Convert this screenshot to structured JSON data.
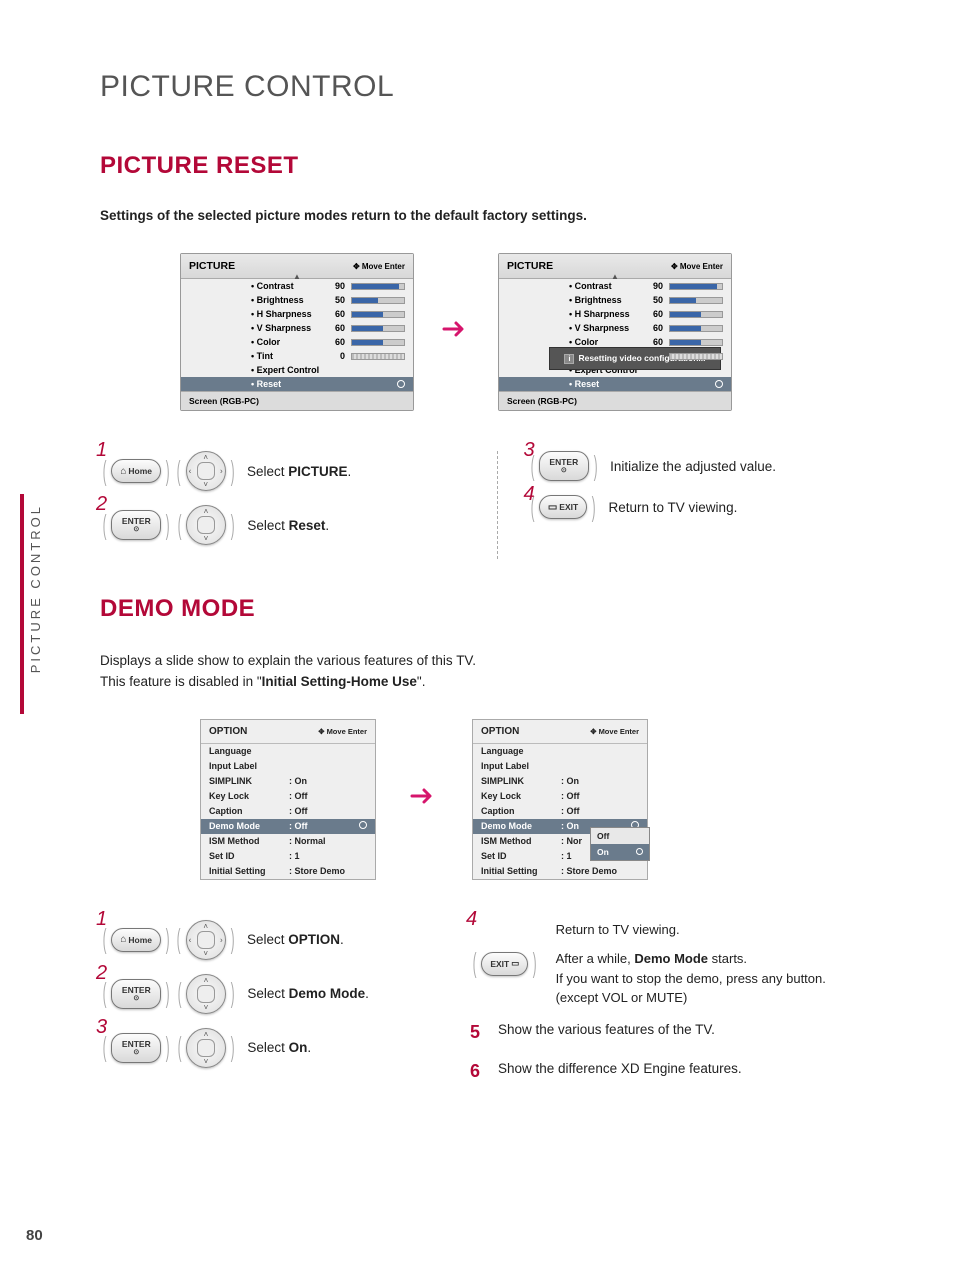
{
  "page_number": "80",
  "side_tab": "PICTURE CONTROL",
  "main_title": "PICTURE CONTROL",
  "section1": {
    "title": "PICTURE RESET",
    "desc": "Settings of the selected picture modes return to the default factory settings.",
    "osd_head_title": "PICTURE",
    "osd_head_hint": "Move    Enter",
    "osd_foot": "Screen (RGB-PC)",
    "rows": [
      {
        "label": "• Contrast",
        "value": "90",
        "fill": 90
      },
      {
        "label": "• Brightness",
        "value": "50",
        "fill": 50
      },
      {
        "label": "• H Sharpness",
        "value": "60",
        "fill": 60
      },
      {
        "label": "• V Sharpness",
        "value": "60",
        "fill": 60
      },
      {
        "label": "• Color",
        "value": "60",
        "fill": 60
      },
      {
        "label": "• Tint",
        "value": "0",
        "fill": 0,
        "tint": true
      },
      {
        "label": "• Expert Control",
        "value": "",
        "nobar": true
      },
      {
        "label": "• Reset",
        "value": "",
        "nobar": true,
        "sel": true,
        "dot": true
      }
    ],
    "popup_text": "Resetting video configuration...",
    "steps_left": [
      {
        "n": "1",
        "btn": "Home",
        "btn_icon": "⌂",
        "pad": "all",
        "text": "Select ",
        "bold": "PICTURE",
        "tail": "."
      },
      {
        "n": "2",
        "btn": "ENTER",
        "btn_sub": "⊙",
        "pad": "vert",
        "text": "Select ",
        "bold": "Reset",
        "tail": "."
      }
    ],
    "steps_right": [
      {
        "n": "3",
        "btn": "ENTER",
        "btn_sub": "⊙",
        "pad": "",
        "text": "Initialize the adjusted value."
      },
      {
        "n": "4",
        "btn": "EXIT",
        "btn_icon": "▭",
        "pad": "",
        "text": "Return to TV viewing."
      }
    ]
  },
  "section2": {
    "title": "DEMO MODE",
    "desc1": "Displays a slide show to explain the various features of this TV.",
    "desc2_pre": "This feature is disabled in \"",
    "desc2_bold": "Initial Setting-Home Use",
    "desc2_post": "\".",
    "osd_head_title": "OPTION",
    "osd_head_hint": "Move    Enter",
    "rows": [
      {
        "label": "Language",
        "value": ""
      },
      {
        "label": "Input Label",
        "value": ""
      },
      {
        "label": "SIMPLINK",
        "value": ": On"
      },
      {
        "label": "Key Lock",
        "value": ": Off"
      },
      {
        "label": "Caption",
        "value": ": Off"
      },
      {
        "label": "Demo Mode",
        "value": ": Off",
        "sel": true,
        "dot": true,
        "alt_value": ": On"
      },
      {
        "label": "ISM Method",
        "value": ": Normal",
        "alt_value": ": Nor"
      },
      {
        "label": "Set ID",
        "value": ": 1"
      },
      {
        "label": "Initial Setting",
        "value": ": Store Demo"
      }
    ],
    "submenu": [
      "Off",
      "On"
    ],
    "steps_left": [
      {
        "n": "1",
        "btn": "Home",
        "btn_icon": "⌂",
        "pad": "all",
        "text": "Select ",
        "bold": "OPTION",
        "tail": "."
      },
      {
        "n": "2",
        "btn": "ENTER",
        "btn_sub": "⊙",
        "pad": "vert",
        "text": "Select ",
        "bold": "Demo Mode",
        "tail": "."
      },
      {
        "n": "3",
        "btn": "ENTER",
        "btn_sub": "⊙",
        "pad": "vert",
        "text": "Select ",
        "bold": "On",
        "tail": "."
      }
    ],
    "step4": {
      "n": "4",
      "btn": "EXIT",
      "btn_icon": "▭",
      "line1": "Return to TV viewing.",
      "line2_pre": "After a while, ",
      "line2_bold": "Demo Mode",
      "line2_post": " starts.",
      "line3": "If you want to stop the demo, press any button.",
      "line4": "(except VOL or MUTE)"
    },
    "step5": {
      "n": "5",
      "text": "Show the various features of the TV."
    },
    "step6": {
      "n": "6",
      "text": "Show the difference XD Engine features."
    }
  }
}
